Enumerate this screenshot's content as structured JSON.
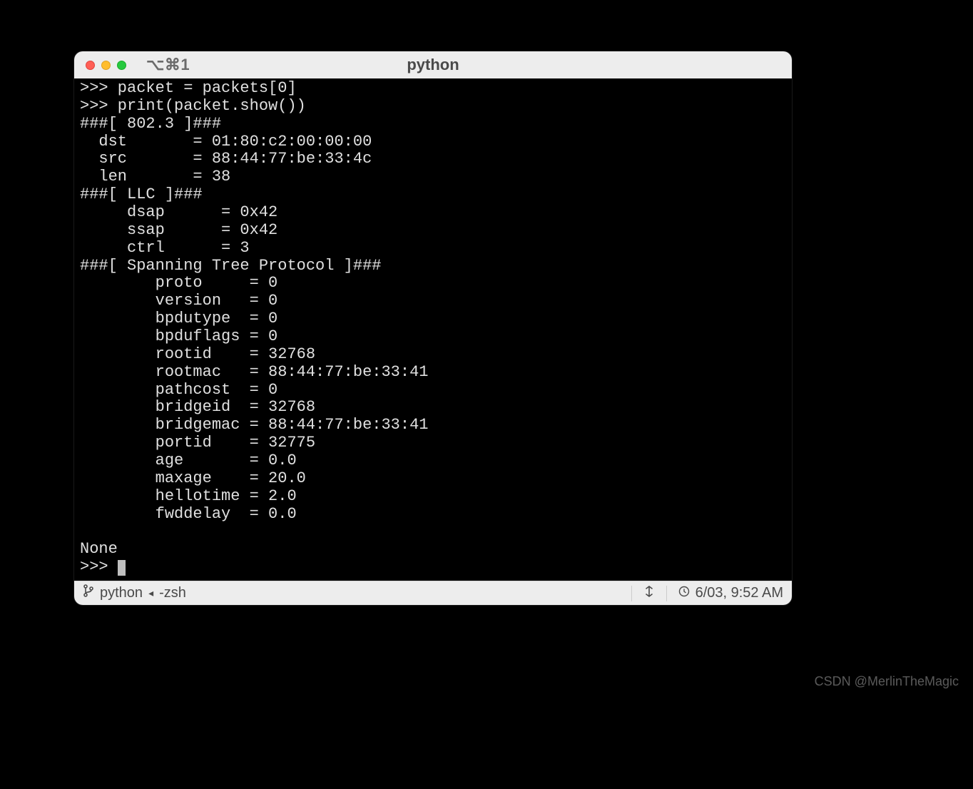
{
  "window": {
    "tab_indicator": "⌥⌘1",
    "title": "python"
  },
  "terminal": {
    "lines": [
      ">>> packet = packets[0]",
      ">>> print(packet.show())",
      "###[ 802.3 ]###",
      "  dst       = 01:80:c2:00:00:00",
      "  src       = 88:44:77:be:33:4c",
      "  len       = 38",
      "###[ LLC ]###",
      "     dsap      = 0x42",
      "     ssap      = 0x42",
      "     ctrl      = 3",
      "###[ Spanning Tree Protocol ]###",
      "        proto     = 0",
      "        version   = 0",
      "        bpdutype  = 0",
      "        bpduflags = 0",
      "        rootid    = 32768",
      "        rootmac   = 88:44:77:be:33:41",
      "        pathcost  = 0",
      "        bridgeid  = 32768",
      "        bridgemac = 88:44:77:be:33:41",
      "        portid    = 32775",
      "        age       = 0.0",
      "        maxage    = 20.0",
      "        hellotime = 2.0",
      "        fwddelay  = 0.0",
      "",
      "None",
      ">>> "
    ]
  },
  "statusbar": {
    "process": "python",
    "separator": "◂",
    "shell": "-zsh",
    "timestamp": "6/03, 9:52 AM"
  },
  "watermark": "CSDN @MerlinTheMagic"
}
